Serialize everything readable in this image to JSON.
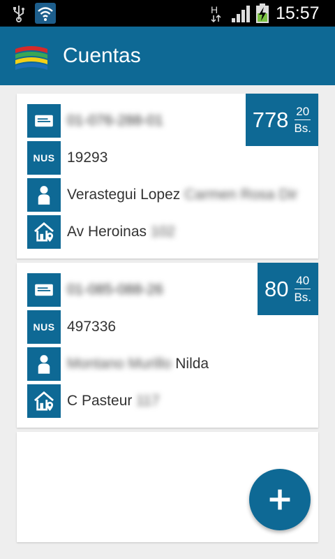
{
  "status_bar": {
    "time": "15:57",
    "network_type": "H",
    "icons": [
      "usb-icon",
      "wifi-icon",
      "signal-icon",
      "battery-icon"
    ]
  },
  "app_bar": {
    "title": "Cuentas",
    "logo": "app-logo"
  },
  "accounts": [
    {
      "account_number": "01-076-288-01",
      "nus": "19293",
      "name_visible": "Verastegui Lopez",
      "name_blurred": "Carmen Rosa Dir",
      "address_visible": "Av Heroinas",
      "address_blurred": "102",
      "amount": {
        "integer": "778",
        "cents": "20",
        "currency": "Bs."
      }
    },
    {
      "account_number": "01-085-088-26",
      "nus": "497336",
      "name_blurred": "Montano Murillo",
      "name_visible": "Nilda",
      "address_visible": "C Pasteur",
      "address_blurred": "117",
      "amount": {
        "integer": "80",
        "cents": "40",
        "currency": "Bs."
      }
    }
  ],
  "labels": {
    "nus": "NUS"
  },
  "fab": {
    "icon": "plus-icon"
  },
  "colors": {
    "primary": "#0e6995",
    "background": "#eeeeee",
    "card": "#ffffff"
  }
}
